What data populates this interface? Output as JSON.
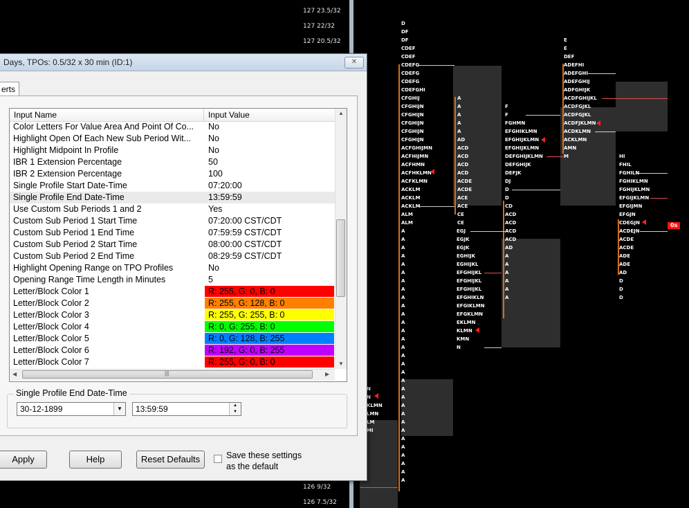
{
  "chart": {
    "price_labels": [
      "127 23.5/32",
      "127 22/32",
      "127 20.5/32",
      "126 9/32",
      "126 7.5/32"
    ],
    "price_tag": "0s",
    "colors": {
      "tpo_text": "#ffffff",
      "va_box": "#2e2e2e",
      "poc_line": "#d07020",
      "marker": "#ff2020"
    },
    "columns": [
      {
        "letters": [
          "D",
          "DF",
          "DF",
          "CDEF",
          "CDEF",
          "CDEFG",
          "CDEFG",
          "CDEFG",
          "CDEFGHI",
          "CFGHIJ",
          "CFGHIJN",
          "CFGHIJN",
          "CFGHIJN",
          "CFGHIJN",
          "CFGHIJN",
          "ACFGHIJMN",
          "ACFHIJMN",
          "ACFHMN",
          "ACFHKLMN",
          "ACFKLMN",
          "ACKLM",
          "ACKLM",
          "ACKLM",
          "ALM",
          "ALM",
          "A",
          "A",
          "A",
          "A",
          "A",
          "A",
          "A",
          "A",
          "A",
          "A",
          "A",
          "A",
          "A",
          "A",
          "A",
          "A",
          "A",
          "A",
          "A",
          "A",
          "A",
          "A",
          "A",
          "A",
          "A",
          "A",
          "A",
          "A",
          "A",
          "A",
          "A"
        ]
      },
      {
        "letters": [
          "A",
          "A",
          "A",
          "A",
          "A",
          "AD",
          "ACD",
          "ACD",
          "ACD",
          "ACD",
          "ACDE",
          "ACDE",
          "ACE",
          "ACE",
          "CE",
          "CE"
        ]
      },
      {
        "letters": [
          "EGJ",
          "EGJK",
          "EGJK",
          "EGHIJK",
          "EGHIJKL",
          "EFGHIJKL",
          "EFGHIJKL",
          "EFGHIJKL",
          "EFGHIKLN",
          "EFGIKLMN",
          "EFGKLMN",
          "EKLMN",
          "KLMN",
          "KMN",
          "N"
        ]
      },
      {
        "letters": [
          "CD",
          "ACD",
          "ACD",
          "ACD",
          "ACD",
          "AD",
          "A",
          "A",
          "A",
          "A",
          "A",
          "A"
        ]
      },
      {
        "letters": [
          "F",
          "F",
          "FGHMN",
          "EFGHIKLMN",
          "EFGHIJKLMN",
          "EFGHIJKLMN",
          "DEFGHIJKLMN",
          "DEFGHIJK",
          "DEFJK",
          "DJ",
          "D",
          "D"
        ]
      },
      {
        "letters": [
          "E",
          "E",
          "DEF",
          "ADEFHI",
          "ADEFGHI",
          "ADEFGHIJ",
          "ADFGHIJK",
          "ACDFGHIJKL",
          "ACDFGJKL",
          "ACDFGJKL",
          "ACDFJKLMN",
          "ACDKLMN",
          "ACKLMN",
          "AMN",
          "M"
        ]
      },
      {
        "letters": [
          "HI",
          "FHIL",
          "FGHILN",
          "FGHIKLMN",
          "FGHIJKLMN",
          "EFGIJKLMN",
          "EFGIJMN",
          "EFGJN",
          "CDEGJN",
          "ACDEJN",
          "ACDE",
          "ACDE",
          "ADE",
          "ADE",
          "AD",
          "D",
          "D",
          "D"
        ]
      },
      {
        "letters": [
          "N",
          "N",
          "KLMN",
          "LMN",
          "LM",
          "MI"
        ]
      }
    ]
  },
  "dialog": {
    "title": "Days, TPOs: 0.5/32 x 30 min    (ID:1)",
    "tab_label": "erts",
    "close_label": "✕",
    "grid": {
      "headers": [
        "Input Name",
        "Input Value"
      ],
      "rows": [
        {
          "name": "Color Letters For Value Area And Point Of Co...",
          "value": "No"
        },
        {
          "name": "Highlight Open Of Each New Sub Period Wit...",
          "value": "No"
        },
        {
          "name": "Highlight Midpoint In Profile",
          "value": "No"
        },
        {
          "name": "IBR 1 Extension Percentage",
          "value": "50"
        },
        {
          "name": "IBR 2 Extension Percentage",
          "value": "100"
        },
        {
          "name": "Single Profile Start Date-Time",
          "value": "07:20:00"
        },
        {
          "name": "Single Profile End Date-Time",
          "value": "13:59:59"
        },
        {
          "name": "Use Custom Sub Periods 1 and 2",
          "value": "Yes"
        },
        {
          "name": "Custom Sub Period 1 Start Time",
          "value": "07:20:00 CST/CDT"
        },
        {
          "name": "Custom Sub Period 1 End Time",
          "value": "07:59:59 CST/CDT"
        },
        {
          "name": "Custom Sub Period 2 Start Time",
          "value": "08:00:00 CST/CDT"
        },
        {
          "name": "Custom Sub Period 2 End Time",
          "value": "08:29:59 CST/CDT"
        },
        {
          "name": "Highlight Opening Range on TPO Profiles",
          "value": "No"
        },
        {
          "name": "Opening Range Time Length in Minutes",
          "value": "5"
        },
        {
          "name": "Letter/Block Color 1",
          "value": "R: 255, G: 0, B: 0",
          "color": "#ff0000"
        },
        {
          "name": "Letter/Block Color 2",
          "value": "R: 255, G: 128, B: 0",
          "color": "#ff8000"
        },
        {
          "name": "Letter/Block Color 3",
          "value": "R: 255, G: 255, B: 0",
          "color": "#ffff00"
        },
        {
          "name": "Letter/Block Color 4",
          "value": "R: 0, G: 255, B: 0",
          "color": "#00ff00"
        },
        {
          "name": "Letter/Block Color 5",
          "value": "R: 0, G: 128, B: 255",
          "color": "#0080ff"
        },
        {
          "name": "Letter/Block Color 6",
          "value": "R: 192, G: 0, B: 255",
          "color": "#c000ff"
        },
        {
          "name": "Letter/Block Color 7",
          "value": "R: 255, G: 0, B: 0",
          "color": "#ff0000"
        }
      ]
    },
    "group_label": "Single Profile End Date-Time",
    "date_value": "30-12-1899",
    "time_value": "13:59:59",
    "buttons": {
      "apply": "Apply",
      "help": "Help",
      "reset": "Reset Defaults"
    },
    "save_label_line1": "Save these settings",
    "save_label_line2": "as the default"
  }
}
